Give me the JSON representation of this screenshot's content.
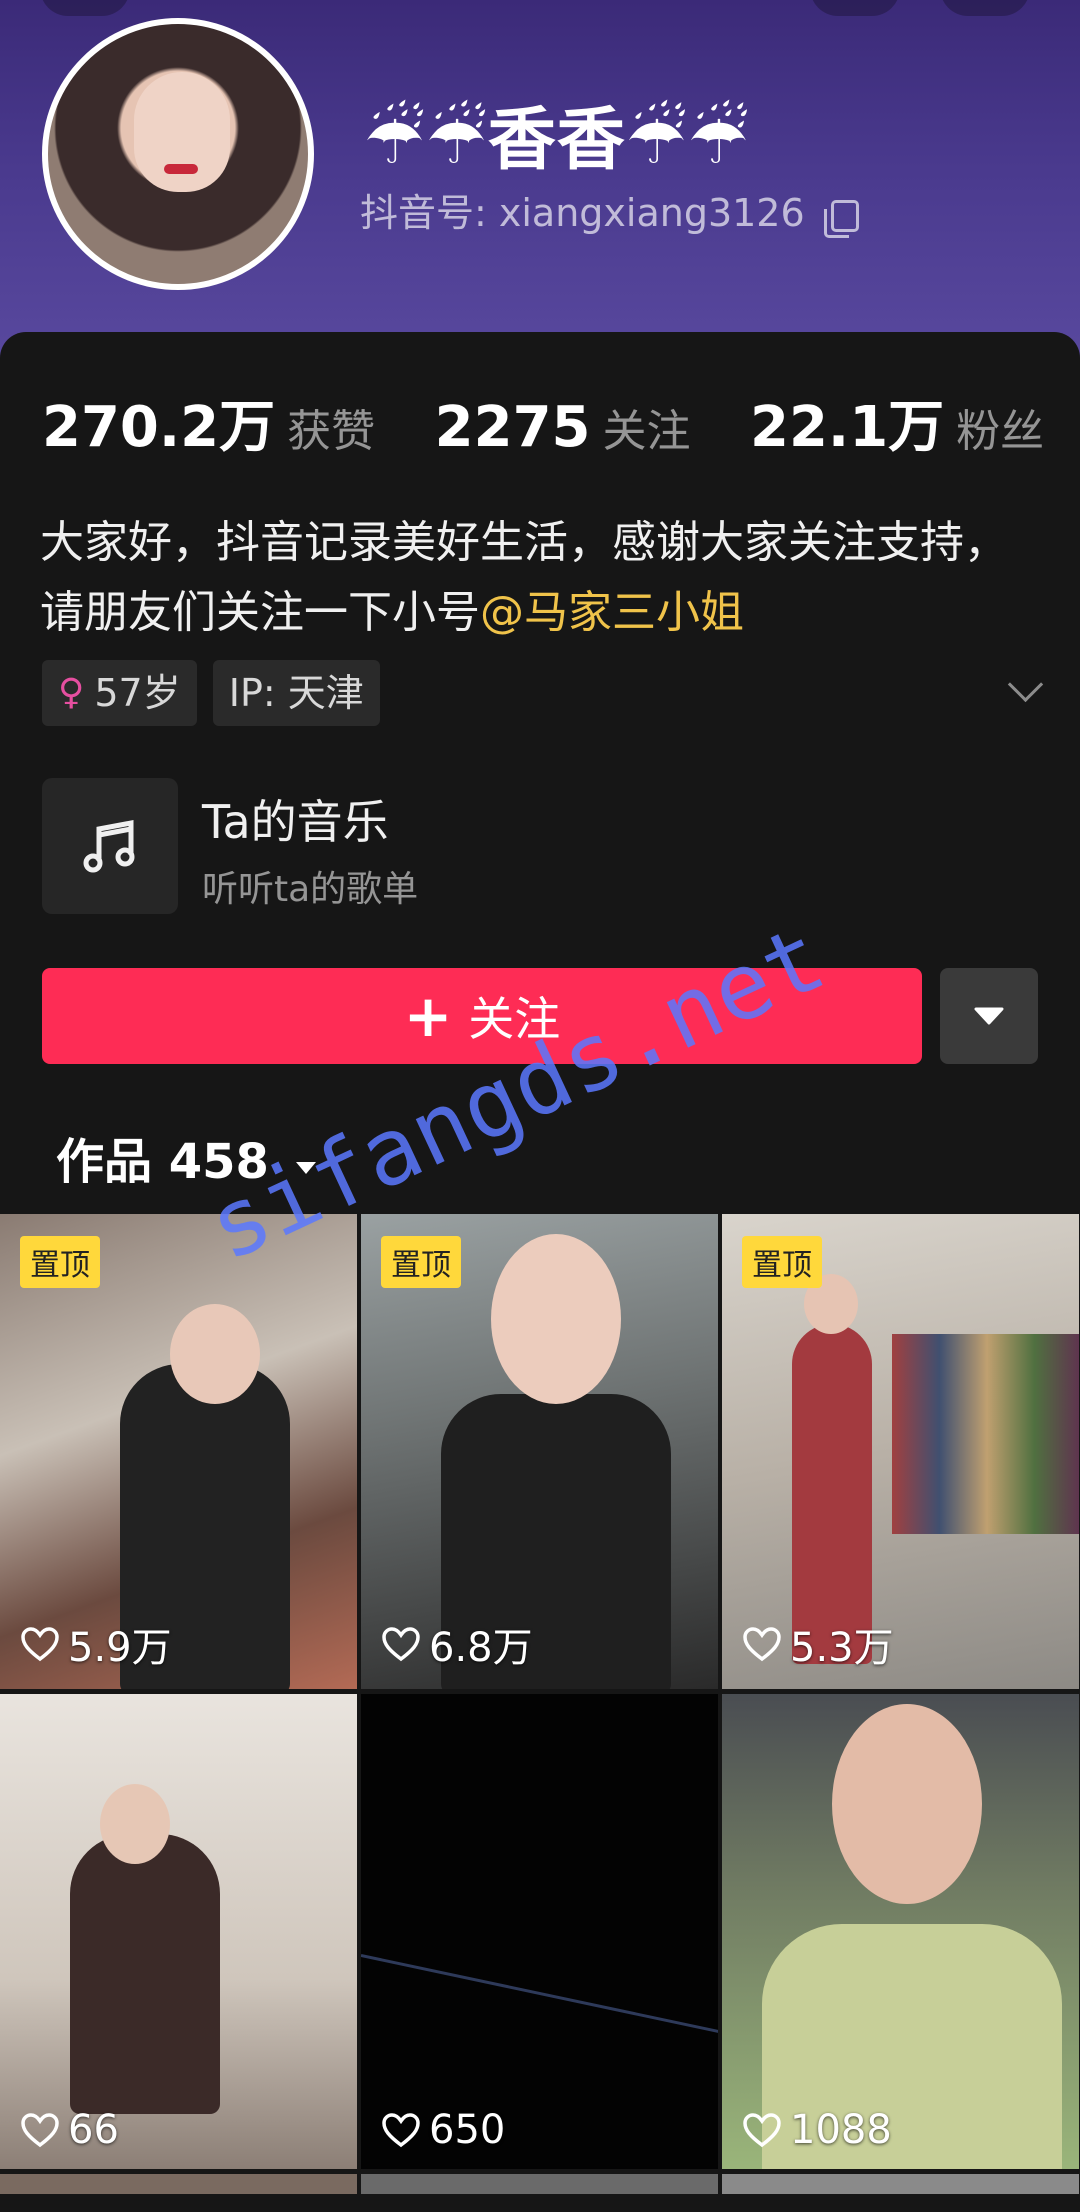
{
  "profile": {
    "name": "☔☔香香☔☔",
    "douyin_id": "抖音号: xiangxiang3126"
  },
  "stats": [
    {
      "value": "270.2万",
      "label": "获赞"
    },
    {
      "value": "2275",
      "label": "关注"
    },
    {
      "value": "22.1万",
      "label": "粉丝"
    }
  ],
  "bio": {
    "text": "大家好，抖音记录美好生活，感谢大家关注支持，请朋友们关注一下小号",
    "mention": "@马家三小姐"
  },
  "tags": {
    "age": "57岁",
    "ip": "IP: 天津"
  },
  "music": {
    "title": "Ta的音乐",
    "subtitle": "听听ta的歌单"
  },
  "actions": {
    "follow_label": "关注"
  },
  "works": {
    "label": "作品 458"
  },
  "videos": [
    {
      "pinned": "置顶",
      "likes": "5.9万"
    },
    {
      "pinned": "置顶",
      "likes": "6.8万"
    },
    {
      "pinned": "置顶",
      "likes": "5.3万"
    },
    {
      "likes": "66"
    },
    {
      "likes": "650"
    },
    {
      "likes": "1088"
    }
  ],
  "watermark": "sifangds.net",
  "colors": {
    "accent": "#fe2c55",
    "mention": "#f0c34a",
    "pin_badge": "#ffd83b",
    "header": "#3b2a78",
    "background": "#161616"
  }
}
